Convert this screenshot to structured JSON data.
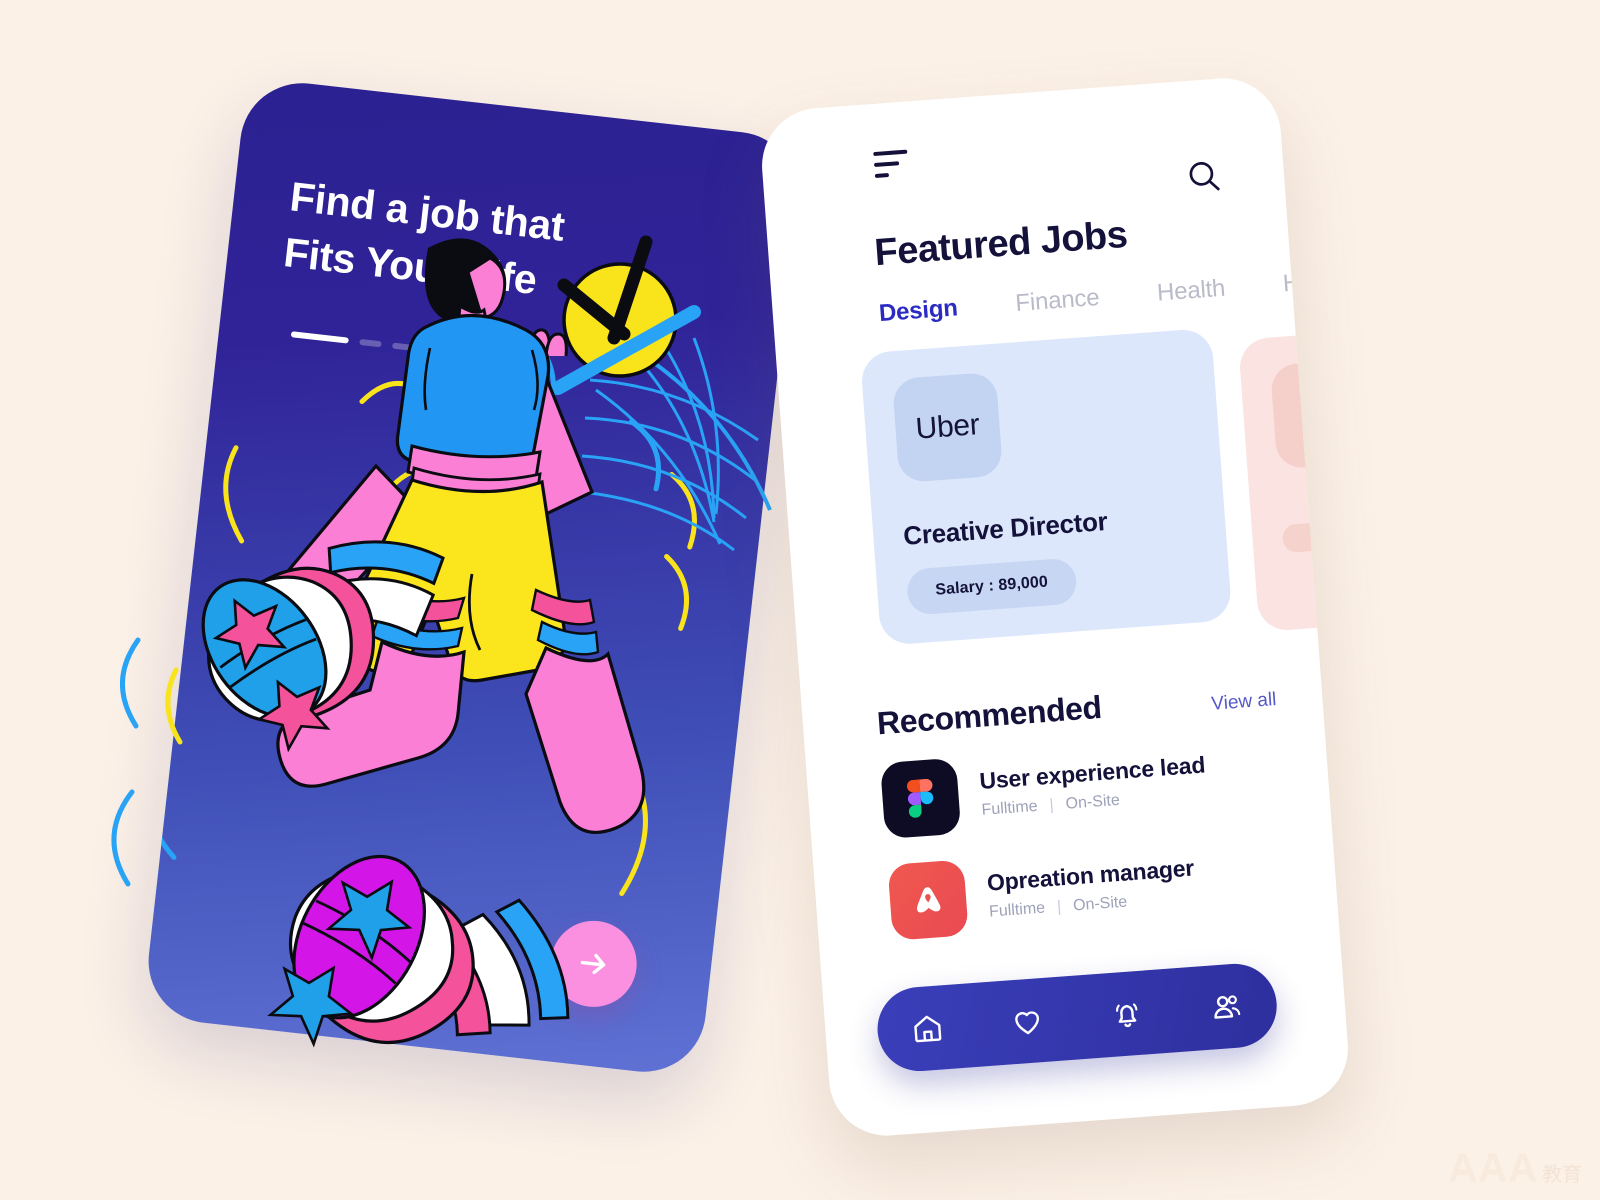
{
  "background_color": "#FCF1E7",
  "onboarding": {
    "name": "onboarding-screen",
    "headline": "Find a job that Fits Your Life",
    "headline_line1": "Find a job that",
    "headline_line2": "Fits Your Life",
    "gradient_from": "#2B2191",
    "gradient_to": "#6072D4",
    "pagination": {
      "active_index": 0,
      "total": 4
    },
    "next_button": {
      "icon": "arrow-right-icon",
      "color": "#FB8FE0",
      "label": "Next"
    },
    "illustration": {
      "name": "jumping-person-illustration",
      "elements": [
        "clock-face",
        "volleyball-net",
        "sneaker-star-blue",
        "sneaker-star-magenta",
        "yellow-squiggle",
        "blue-squiggle"
      ],
      "colors": {
        "skin": "#FB7FD4",
        "shirt": "#2196F3",
        "shorts": "#FBE51C",
        "hair": "#0B0B12",
        "shoe_magenta": "#D415E8",
        "shoe_blue": "#1FA0E8",
        "shoe_pink": "#F4529B",
        "clock": "#F9E31A"
      }
    }
  },
  "app": {
    "name": "featured-jobs-screen",
    "topbar": {
      "menu_icon": "hamburger-menu-icon",
      "search_icon": "search-icon"
    },
    "title": "Featured Jobs",
    "tabs": [
      {
        "label": "Design",
        "active": true
      },
      {
        "label": "Finance",
        "active": false
      },
      {
        "label": "Health",
        "active": false
      },
      {
        "label": "Hotel",
        "active": false
      }
    ],
    "active_tab_color": "#2B2BC4",
    "featured": [
      {
        "company": "Uber",
        "role": "Creative Director",
        "salary_label": "Salary : 89,000",
        "card_color": "#DCE7FB"
      },
      {
        "company": "",
        "role": "",
        "salary_label": "",
        "card_color": "#FBE3E1"
      }
    ],
    "recommended": {
      "title": "Recommended",
      "view_all": "View all",
      "items": [
        {
          "logo": "figma-logo-icon",
          "role": "User experience lead",
          "employment": "Fulltime",
          "separator": "|",
          "location": "On-Site"
        },
        {
          "logo": "airbnb-logo-icon",
          "role": "Opreation manager",
          "employment": "Fulltime",
          "separator": "|",
          "location": "On-Site"
        }
      ]
    },
    "bottom_nav": [
      {
        "icon": "home-icon",
        "active": true
      },
      {
        "icon": "heart-icon",
        "active": false
      },
      {
        "icon": "bell-icon",
        "active": false
      },
      {
        "icon": "people-icon",
        "active": false
      }
    ],
    "nav_color": "#2E2F9E"
  },
  "watermark": {
    "text": "AAA",
    "subtext": "教育"
  }
}
